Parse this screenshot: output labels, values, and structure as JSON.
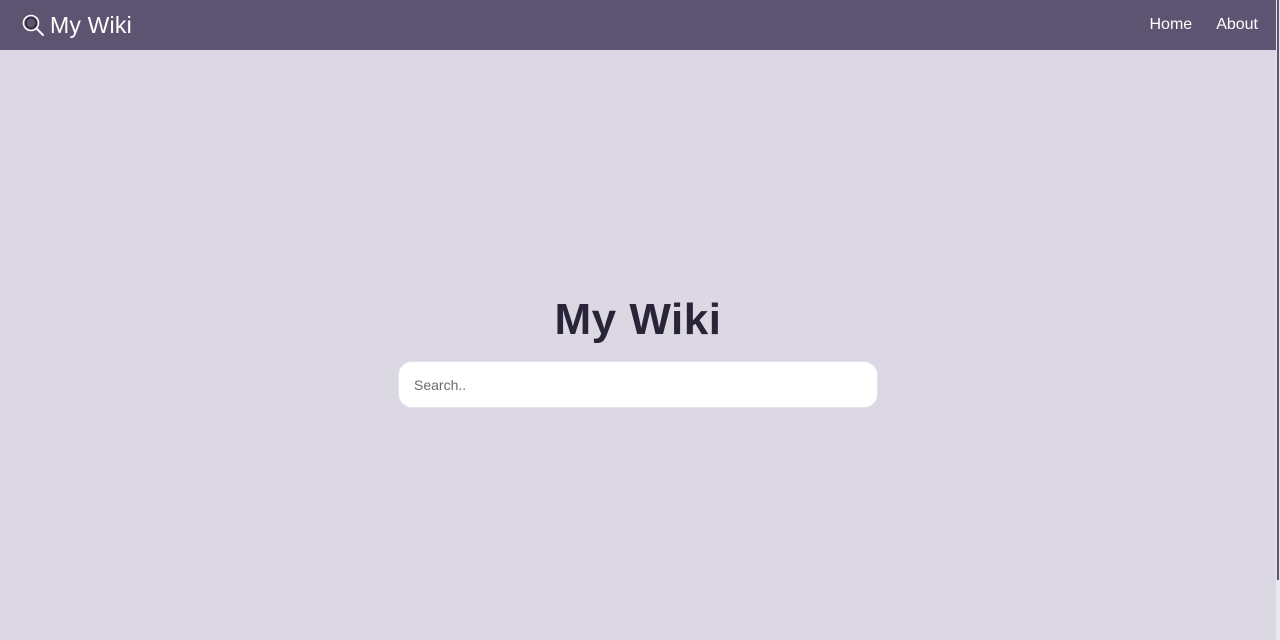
{
  "navbar": {
    "brand_icon": "magnifier-icon",
    "brand_label": "My Wiki",
    "links": [
      {
        "label": "Home"
      },
      {
        "label": "About"
      }
    ]
  },
  "hero": {
    "title": "My Wiki",
    "search": {
      "placeholder": "Search..",
      "value": ""
    }
  },
  "colors": {
    "navbar_bg": "#5c5470",
    "page_bg": "#dbd8e3",
    "title_text": "#2a2438",
    "input_bg": "#ffffff"
  }
}
